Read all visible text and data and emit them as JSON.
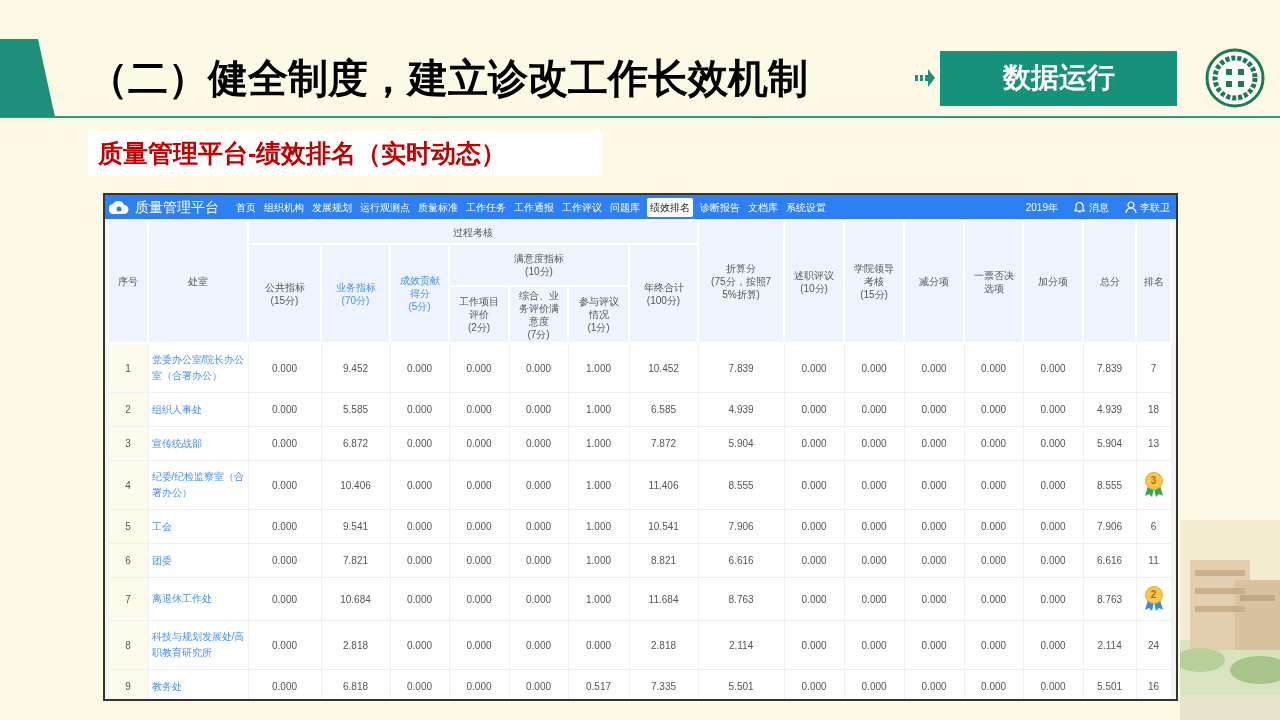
{
  "slide": {
    "title": "（二）健全制度，建立诊改工作长效机制",
    "tag": "数据运行",
    "subtitle": "质量管理平台-绩效排名（实时动态）"
  },
  "app": {
    "brand": "质量管理平台",
    "nav": [
      {
        "label": "首页",
        "selected": false
      },
      {
        "label": "组织机构",
        "selected": false
      },
      {
        "label": "发展规划",
        "selected": false
      },
      {
        "label": "运行观测点",
        "selected": false
      },
      {
        "label": "质量标准",
        "selected": false
      },
      {
        "label": "工作任务",
        "selected": false
      },
      {
        "label": "工作通报",
        "selected": false
      },
      {
        "label": "工作评议",
        "selected": false
      },
      {
        "label": "问题库",
        "selected": false
      },
      {
        "label": "绩效排名",
        "selected": true
      },
      {
        "label": "诊断报告",
        "selected": false
      },
      {
        "label": "文档库",
        "selected": false
      },
      {
        "label": "系统设置",
        "selected": false
      }
    ],
    "year": "2019年",
    "messages": "消息",
    "user": "李联卫"
  },
  "table": {
    "columns": [
      {
        "label": "序号",
        "highlighted": false
      },
      {
        "label": "处室",
        "highlighted": false
      },
      {
        "label": "过程考核",
        "highlighted": false,
        "children": [
          {
            "label": "公共指标\n(15分)",
            "highlighted": false
          },
          {
            "label": "业务指标\n(70分)",
            "highlighted": true
          },
          {
            "label": "成效贡献得分\n(5分)",
            "highlighted": true
          },
          {
            "label": "满意度指标\n(10分)",
            "highlighted": false,
            "children": [
              {
                "label": "工作项目评价\n(2分)",
                "highlighted": false
              },
              {
                "label": "综合、业务评价满意度\n(7分)",
                "highlighted": false
              },
              {
                "label": "参与评议情况\n(1分)",
                "highlighted": false
              }
            ]
          },
          {
            "label": "年终合计\n(100分)",
            "highlighted": false
          }
        ]
      },
      {
        "label": "折算分\n(75分，按照75%折算)",
        "highlighted": false
      },
      {
        "label": "述职评议\n(10分)",
        "highlighted": false
      },
      {
        "label": "学院领导考核\n(15分)",
        "highlighted": false
      },
      {
        "label": "减分项",
        "highlighted": false
      },
      {
        "label": "一票否决选项",
        "highlighted": false
      },
      {
        "label": "加分项",
        "highlighted": false
      },
      {
        "label": "总分",
        "highlighted": false
      },
      {
        "label": "排名",
        "highlighted": false
      }
    ],
    "rows": [
      {
        "no": "1",
        "dept": "党委办公室/院长办公室（合署办公）",
        "values": [
          "0.000",
          "9.452",
          "0.000",
          "0.000",
          "0.000",
          "1.000",
          "10.452",
          "7.839",
          "0.000",
          "0.000",
          "0.000",
          "0.000",
          "0.000",
          "7.839"
        ],
        "rank": {
          "kind": "plain",
          "text": "7"
        }
      },
      {
        "no": "2",
        "dept": "组织人事处",
        "values": [
          "0.000",
          "5.585",
          "0.000",
          "0.000",
          "0.000",
          "1.000",
          "6.585",
          "4.939",
          "0.000",
          "0.000",
          "0.000",
          "0.000",
          "0.000",
          "4.939"
        ],
        "rank": {
          "kind": "plain",
          "text": "18"
        }
      },
      {
        "no": "3",
        "dept": "宣传统战部",
        "values": [
          "0.000",
          "6.872",
          "0.000",
          "0.000",
          "0.000",
          "1.000",
          "7.872",
          "5.904",
          "0.000",
          "0.000",
          "0.000",
          "0.000",
          "0.000",
          "5.904"
        ],
        "rank": {
          "kind": "plain",
          "text": "13"
        }
      },
      {
        "no": "4",
        "dept": "纪委/纪检监察室（合署办公）",
        "values": [
          "0.000",
          "10.406",
          "0.000",
          "0.000",
          "0.000",
          "1.000",
          "11.406",
          "8.555",
          "0.000",
          "0.000",
          "0.000",
          "0.000",
          "0.000",
          "8.555"
        ],
        "rank": {
          "kind": "medal",
          "text": "3",
          "color": "#2fa84f"
        }
      },
      {
        "no": "5",
        "dept": "工会",
        "values": [
          "0.000",
          "9.541",
          "0.000",
          "0.000",
          "0.000",
          "1.000",
          "10.541",
          "7.906",
          "0.000",
          "0.000",
          "0.000",
          "0.000",
          "0.000",
          "7.906"
        ],
        "rank": {
          "kind": "plain",
          "text": "6"
        }
      },
      {
        "no": "6",
        "dept": "团委",
        "values": [
          "0.000",
          "7.821",
          "0.000",
          "0.000",
          "0.000",
          "1.000",
          "8.821",
          "6.616",
          "0.000",
          "0.000",
          "0.000",
          "0.000",
          "0.000",
          "6.616"
        ],
        "rank": {
          "kind": "plain",
          "text": "11"
        }
      },
      {
        "no": "7",
        "dept": "离退休工作处",
        "values": [
          "0.000",
          "10.684",
          "0.000",
          "0.000",
          "0.000",
          "1.000",
          "11.684",
          "8.763",
          "0.000",
          "0.000",
          "0.000",
          "0.000",
          "0.000",
          "8.763"
        ],
        "rank": {
          "kind": "medal",
          "text": "2",
          "color": "#2f8fe0"
        }
      },
      {
        "no": "8",
        "dept": "科技与规划发展处/高职教育研究所",
        "values": [
          "0.000",
          "2.818",
          "0.000",
          "0.000",
          "0.000",
          "0.000",
          "2.818",
          "2.114",
          "0.000",
          "0.000",
          "0.000",
          "0.000",
          "0.000",
          "2.114"
        ],
        "rank": {
          "kind": "plain",
          "text": "24"
        }
      },
      {
        "no": "9",
        "dept": "教务处",
        "values": [
          "0.000",
          "6.818",
          "0.000",
          "0.000",
          "0.000",
          "0.517",
          "7.335",
          "5.501",
          "0.000",
          "0.000",
          "0.000",
          "0.000",
          "0.000",
          "5.501"
        ],
        "rank": {
          "kind": "plain",
          "text": "16"
        }
      }
    ]
  }
}
